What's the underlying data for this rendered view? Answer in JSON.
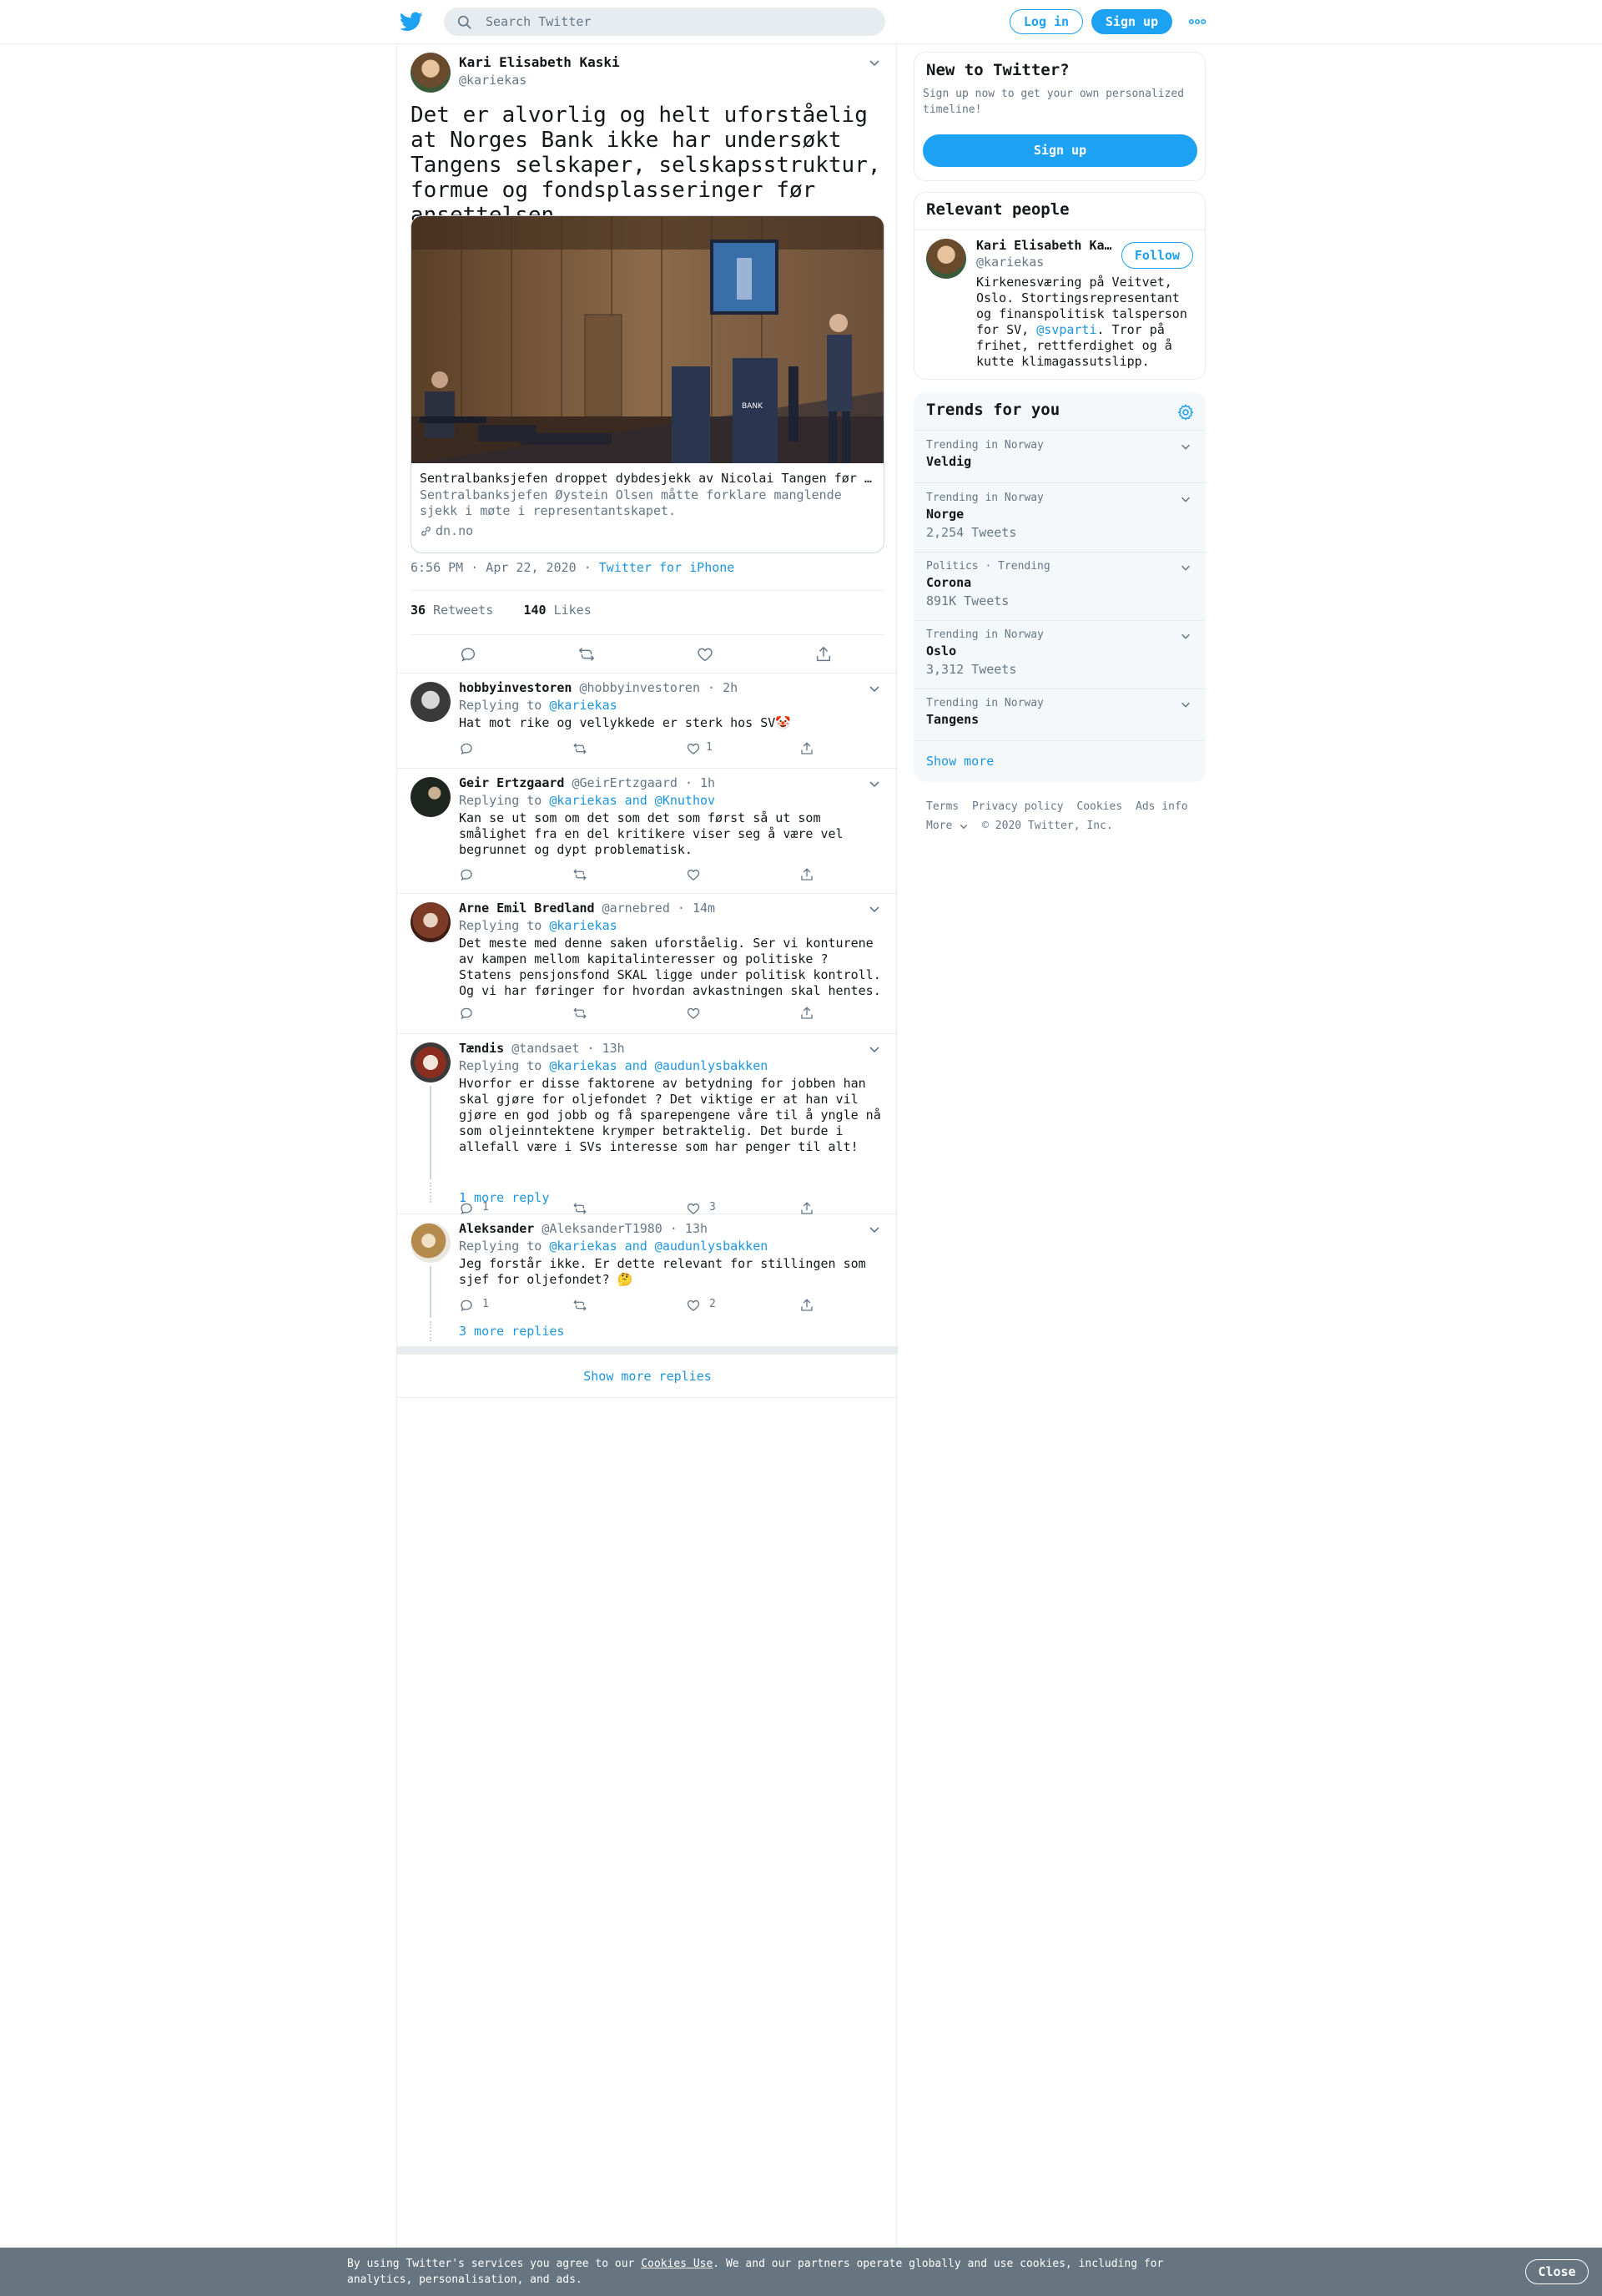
{
  "header": {
    "search_placeholder": "Search Twitter",
    "login_label": "Log in",
    "signup_label": "Sign up",
    "more_icon": "more-icon"
  },
  "main_tweet": {
    "name": "Kari Elisabeth Kaski",
    "handle": "@kariekas",
    "text": "Det er alvorlig og helt uforståelig at Norges Bank ikke har undersøkt Tangens selskaper, selskapsstruktur, formue og fondsplasseringer før ansettelsen.",
    "card": {
      "title": "Sentralbanksjefen droppet dybdesjekk av Nicolai Tangen før ansettelse",
      "description": "Sentralbanksjefen Øystein Olsen måtte forklare manglende sjekk i møte i representantskapet.",
      "domain": "dn.no",
      "image_alt": "NORGES BANK"
    },
    "time": "6:56 PM · Apr 22, 2020",
    "source": "Twitter for iPhone",
    "retweets": "36",
    "retweets_label": "Retweets",
    "likes": "140",
    "likes_label": "Likes"
  },
  "replies": [
    {
      "name": "hobbyinvestoren",
      "handle": "@hobbyinvestoren",
      "time": "2h",
      "replying_prefix": "Replying to",
      "replying_to": "@kariekas",
      "text": "Hat mot rike og vellykkede er sterk hos SV🤡",
      "replies": "",
      "retweets": "",
      "likes": "1"
    },
    {
      "name": "Geir Ertzgaard",
      "handle": "@GeirErtzgaard",
      "time": "1h",
      "replying_prefix": "Replying to",
      "replying_to": "@kariekas and @Knuthov",
      "text": "Kan se ut som om det som det som først så ut som smålighet fra en del kritikere viser seg å være vel begrunnet og dypt problematisk.",
      "replies": "",
      "retweets": "",
      "likes": ""
    },
    {
      "name": "Arne Emil Bredland",
      "handle": "@arnebred",
      "time": "14m",
      "replying_prefix": "Replying to",
      "replying_to": "@kariekas",
      "text": "Det meste med denne saken uforståelig. Ser vi konturene av kampen mellom kapitalinteresser og politiske ? Statens pensjonsfond SKAL ligge under politisk kontroll. Og vi har føringer for hvordan avkastningen skal hentes.",
      "replies": "",
      "retweets": "",
      "likes": ""
    },
    {
      "name": "Tændis",
      "handle": "@tandsaet",
      "time": "13h",
      "replying_prefix": "Replying to",
      "replying_to": "@kariekas and @audunlysbakken",
      "text": "Hvorfor er disse faktorene av betydning for jobben han skal gjøre for oljefondet ? Det viktige er at han vil gjøre en god jobb og få sparepengene våre til å yngle nå som oljeinntektene krymper betraktelig. Det burde i allefall være i SVs interesse som har penger til alt!",
      "replies": "1",
      "retweets": "",
      "likes": "3",
      "more_replies": "1 more reply"
    },
    {
      "name": "Aleksander",
      "handle": "@AleksanderT1980",
      "time": "13h",
      "replying_prefix": "Replying to",
      "replying_to": "@kariekas and @audunlysbakken",
      "text": "Jeg forstår ikke. Er dette relevant for stillingen som sjef for oljefondet? 🤔",
      "replies": "1",
      "retweets": "",
      "likes": "2",
      "more_replies": "3 more replies"
    }
  ],
  "show_more_replies": "Show more replies",
  "sidebar": {
    "new_title": "New to Twitter?",
    "new_desc": "Sign up now to get your own personalized timeline!",
    "new_signup": "Sign up",
    "people_title": "Relevant people",
    "person": {
      "name": "Kari Elisabeth Kaski",
      "handle": "@kariekas",
      "follow": "Follow",
      "bio_before": "Kirkenesværing på Veitvet, Oslo. Stortingsrepresentant og finanspolitisk talsperson for SV, ",
      "bio_link": "@svparti",
      "bio_after": ". Tror på frihet, rettferdighet og å kutte klimagassutslipp."
    },
    "trends_title": "Trends for you",
    "trends": [
      {
        "context": "Trending in Norway",
        "name": "Veldig",
        "count": ""
      },
      {
        "context": "Trending in Norway",
        "name": "Norge",
        "count": "2,254 Tweets"
      },
      {
        "context": "Politics · Trending",
        "name": "Corona",
        "count": "891K Tweets"
      },
      {
        "context": "Trending in Norway",
        "name": "Oslo",
        "count": "3,312 Tweets"
      },
      {
        "context": "Trending in Norway",
        "name": "Tangens",
        "count": ""
      }
    ],
    "show_more": "Show more",
    "footer": {
      "terms": "Terms",
      "privacy": "Privacy policy",
      "cookies": "Cookies",
      "ads": "Ads info",
      "more": "More",
      "copyright": "© 2020 Twitter, Inc."
    }
  },
  "cookie_bar": {
    "before": "By using Twitter's services you agree to our ",
    "link": "Cookies Use",
    "after": ". We and our partners operate globally and use cookies, including for analytics, personalisation, and ads.",
    "close": "Close"
  },
  "colors": {
    "accent": "#1da1f2",
    "link": "#1b95e0",
    "secondary_text": "#657786",
    "border": "#e6ecf0",
    "cookie_bg": "#66757f"
  }
}
